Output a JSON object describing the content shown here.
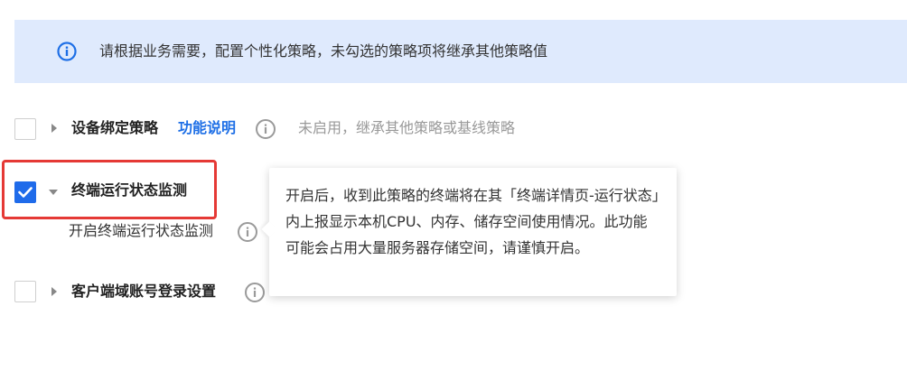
{
  "notice": {
    "icon": "info-circle-icon",
    "text": "请根据业务需要，配置个性化策略，未勾选的策略项将继承其他策略值",
    "background": "#dfeafd",
    "accent": "#1e6fe6"
  },
  "policies": [
    {
      "title": "设备绑定策略",
      "checked": false,
      "expanded": false,
      "link_label": "功能说明",
      "status_text": "未启用，继承其他策略或基线策略"
    },
    {
      "title": "终端运行状态监测",
      "checked": true,
      "expanded": true,
      "option_label": "开启终端运行状态监测"
    },
    {
      "title": "客户端域账号登录设置",
      "checked": false,
      "expanded": false
    }
  ],
  "tooltip": {
    "text": "开启后，收到此策略的终端将在其「终端详情页-运行状态」内上报显示本机CPU、内存、储存空间使用情况。此功能可能会占用大量服务器存储空间，请谨慎开启。"
  },
  "colors": {
    "primary": "#1f6bea",
    "highlight": "#e53935",
    "muted_text": "#999999"
  }
}
